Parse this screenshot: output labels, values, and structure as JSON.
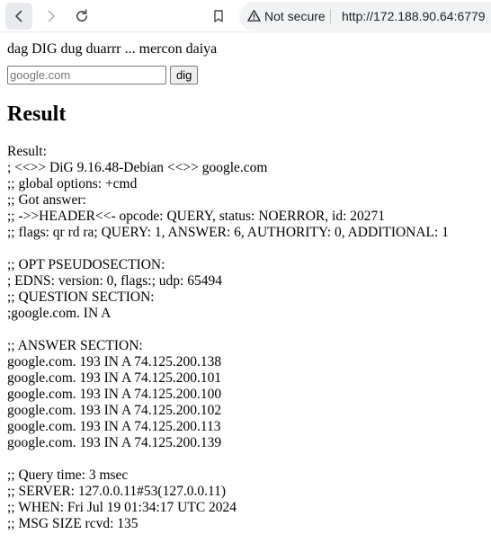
{
  "browser": {
    "security_label": "Not secure",
    "url": "http://172.188.90.64:6779",
    "icons": {
      "back": "arrow-left-icon",
      "forward": "arrow-right-icon",
      "reload": "reload-icon",
      "bookmark": "bookmark-icon",
      "warning": "warning-triangle-icon"
    }
  },
  "page": {
    "intro_text": "dag DIG dug duarrr ... mercon daiya",
    "form": {
      "domain_placeholder": "google.com",
      "domain_value": "",
      "submit_label": "dig"
    },
    "result_heading": "Result",
    "result_lines": [
      "Result:",
      "; <<>> DiG 9.16.48-Debian <<>> google.com",
      ";; global options: +cmd",
      ";; Got answer:",
      ";; ->>HEADER<<- opcode: QUERY, status: NOERROR, id: 20271",
      ";; flags: qr rd ra; QUERY: 1, ANSWER: 6, AUTHORITY: 0, ADDITIONAL: 1",
      "",
      ";; OPT PSEUDOSECTION:",
      "; EDNS: version: 0, flags:; udp: 65494",
      ";; QUESTION SECTION:",
      ";google.com. IN A",
      "",
      ";; ANSWER SECTION:",
      "google.com. 193 IN A 74.125.200.138",
      "google.com. 193 IN A 74.125.200.101",
      "google.com. 193 IN A 74.125.200.100",
      "google.com. 193 IN A 74.125.200.102",
      "google.com. 193 IN A 74.125.200.113",
      "google.com. 193 IN A 74.125.200.139",
      "",
      ";; Query time: 3 msec",
      ";; SERVER: 127.0.0.11#53(127.0.0.11)",
      ";; WHEN: Fri Jul 19 01:34:17 UTC 2024",
      ";; MSG SIZE rcvd: 135"
    ]
  }
}
